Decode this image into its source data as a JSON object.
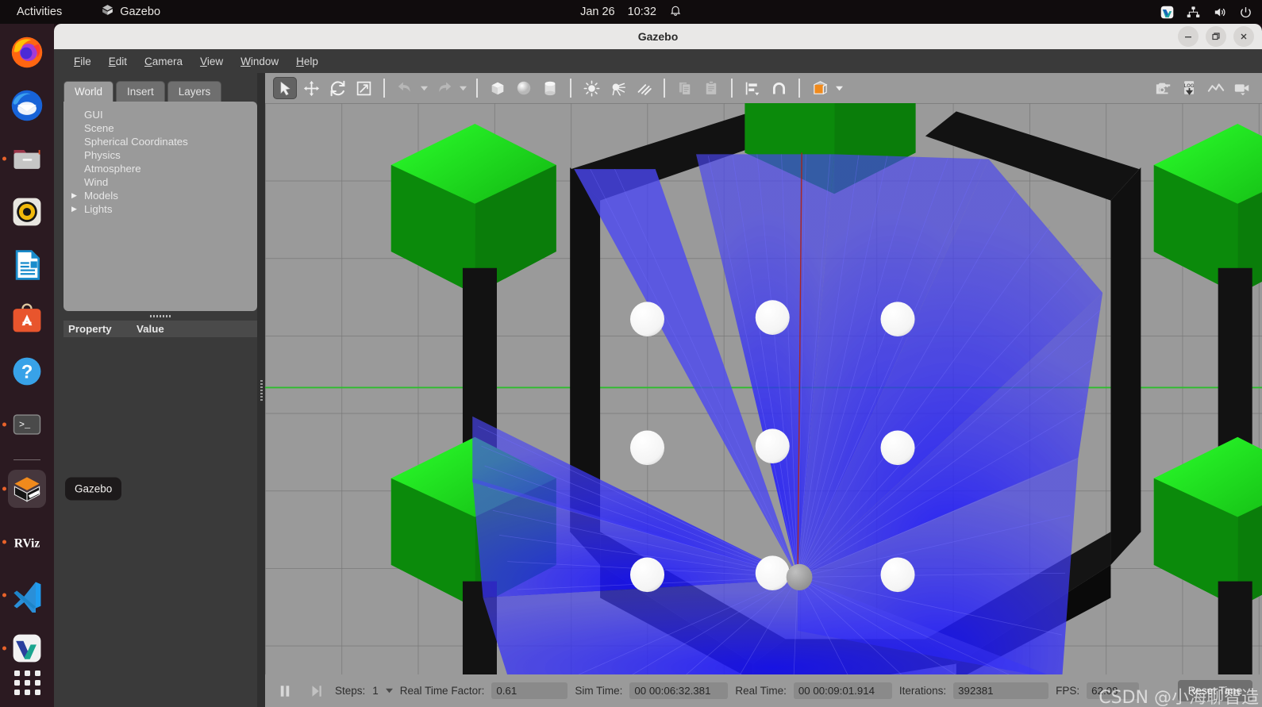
{
  "topbar": {
    "activities": "Activities",
    "app_name": "Gazebo",
    "app_icon": "gazebo-icon",
    "date": "Jan 26",
    "time": "10:32",
    "bell_icon": "notification-bell-icon",
    "tray": [
      {
        "name": "wps-tray-icon",
        "label": ""
      },
      {
        "name": "network-icon",
        "label": ""
      },
      {
        "name": "volume-icon",
        "label": ""
      },
      {
        "name": "power-icon",
        "label": ""
      }
    ]
  },
  "dock": {
    "tooltip": "Gazebo",
    "items": [
      {
        "name": "firefox",
        "label": "Firefox",
        "running": false
      },
      {
        "name": "thunderbird",
        "label": "Thunderbird",
        "running": false
      },
      {
        "name": "files",
        "label": "Files",
        "running": true
      },
      {
        "name": "rhythmbox",
        "label": "Rhythmbox",
        "running": false
      },
      {
        "name": "libreoffice-writer",
        "label": "LibreOffice Writer",
        "running": false
      },
      {
        "name": "ubuntu-software",
        "label": "Ubuntu Software",
        "running": false
      },
      {
        "name": "help",
        "label": "Help",
        "running": false
      },
      {
        "name": "terminal",
        "label": "Terminal",
        "running": true
      },
      {
        "name": "gazebo",
        "label": "Gazebo",
        "running": true,
        "active": true
      },
      {
        "name": "rviz",
        "label": "RViz",
        "running": true
      },
      {
        "name": "vscode",
        "label": "Visual Studio Code",
        "running": true
      },
      {
        "name": "wps-office",
        "label": "WPS Office",
        "running": true
      }
    ],
    "show_apps": "Show Applications"
  },
  "window": {
    "title": "Gazebo",
    "buttons": {
      "minimize": "–",
      "maximize": "❐",
      "close": "✕"
    }
  },
  "menu": [
    {
      "name": "file",
      "pre": "",
      "mnem": "F",
      "post": "ile"
    },
    {
      "name": "edit",
      "pre": "",
      "mnem": "E",
      "post": "dit"
    },
    {
      "name": "camera",
      "pre": "",
      "mnem": "C",
      "post": "amera"
    },
    {
      "name": "view",
      "pre": "",
      "mnem": "V",
      "post": "iew"
    },
    {
      "name": "window",
      "pre": "",
      "mnem": "W",
      "post": "indow"
    },
    {
      "name": "help",
      "pre": "",
      "mnem": "H",
      "post": "elp"
    }
  ],
  "left_panel": {
    "tabs": [
      {
        "label": "World",
        "active": true
      },
      {
        "label": "Insert",
        "active": false
      },
      {
        "label": "Layers",
        "active": false
      }
    ],
    "tree": [
      {
        "label": "GUI",
        "expandable": false
      },
      {
        "label": "Scene",
        "expandable": false
      },
      {
        "label": "Spherical Coordinates",
        "expandable": false
      },
      {
        "label": "Physics",
        "expandable": false
      },
      {
        "label": "Atmosphere",
        "expandable": false
      },
      {
        "label": "Wind",
        "expandable": false
      },
      {
        "label": "Models",
        "expandable": true
      },
      {
        "label": "Lights",
        "expandable": true
      }
    ],
    "property_header": {
      "property": "Property",
      "value": "Value"
    }
  },
  "toolbar": {
    "left": [
      {
        "name": "select-mode-button",
        "icon": "cursor-arrow-icon",
        "state": "pressed"
      },
      {
        "name": "translate-mode-button",
        "icon": "move-arrows-icon",
        "state": "normal"
      },
      {
        "name": "rotate-mode-button",
        "icon": "rotate-icon",
        "state": "normal"
      },
      {
        "name": "scale-mode-button",
        "icon": "scale-icon",
        "state": "normal"
      },
      {
        "name": "undo-button",
        "icon": "undo-arrow-icon",
        "state": "disabled"
      },
      {
        "name": "undo-history-button",
        "icon": "chevron-down-icon",
        "state": "disabled"
      },
      {
        "name": "redo-button",
        "icon": "redo-arrow-icon",
        "state": "disabled"
      },
      {
        "name": "redo-history-button",
        "icon": "chevron-down-icon",
        "state": "disabled"
      },
      {
        "name": "insert-box-button",
        "icon": "box-icon",
        "state": "normal"
      },
      {
        "name": "insert-sphere-button",
        "icon": "sphere-icon",
        "state": "normal"
      },
      {
        "name": "insert-cylinder-button",
        "icon": "cylinder-icon",
        "state": "normal"
      },
      {
        "name": "point-light-button",
        "icon": "point-light-icon",
        "state": "normal"
      },
      {
        "name": "spot-light-button",
        "icon": "spot-light-icon",
        "state": "normal"
      },
      {
        "name": "directional-light-button",
        "icon": "directional-light-icon",
        "state": "normal"
      },
      {
        "name": "copy-button",
        "icon": "copy-icon",
        "state": "disabled"
      },
      {
        "name": "paste-button",
        "icon": "paste-icon",
        "state": "disabled"
      },
      {
        "name": "align-button",
        "icon": "align-icon",
        "state": "normal"
      },
      {
        "name": "snap-button",
        "icon": "magnet-icon",
        "state": "normal"
      },
      {
        "name": "view-mode-button",
        "icon": "orange-cube-icon",
        "state": "normal"
      }
    ],
    "right": [
      {
        "name": "screenshot-button",
        "icon": "camera-icon"
      },
      {
        "name": "log-record-button",
        "icon": "log-download-icon"
      },
      {
        "name": "plot-button",
        "icon": "plot-line-icon"
      },
      {
        "name": "video-record-button",
        "icon": "video-camera-icon"
      }
    ]
  },
  "statusbar": {
    "pause_icon": "pause-icon",
    "step_icon": "step-forward-icon",
    "steps_label": "Steps:",
    "steps_value": "1",
    "real_time_factor_label": "Real Time Factor:",
    "real_time_factor_value": "0.61",
    "sim_time_label": "Sim Time:",
    "sim_time_value": "00 00:06:32.381",
    "real_time_label": "Real Time:",
    "real_time_value": "00 00:09:01.914",
    "iterations_label": "Iterations:",
    "iterations_value": "392381",
    "fps_label": "FPS:",
    "fps_value": "62.08",
    "reset_time_label": "Reset Time"
  },
  "watermark": "CSDN @小海聊智造",
  "scene": {
    "ground_color": "#9a9a9a",
    "grid_color": "#777777",
    "tree_top_color": "#0f9b0f",
    "tree_trunk_color": "#0d0d0d",
    "laser_color": "#3a36ef",
    "sphere_color": "#ffffff",
    "axis_green": "#22c322",
    "axis_red": "#9e2020",
    "sensor_origin_color": "#9b9b9b"
  }
}
